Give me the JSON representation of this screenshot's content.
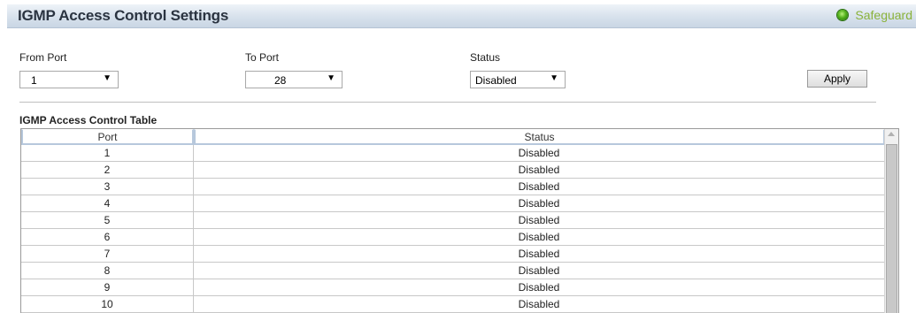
{
  "header": {
    "title": "IGMP Access Control Settings",
    "safeguard_label": "Safeguard",
    "safeguard_icon": "status-dot-icon"
  },
  "form": {
    "from_port_label": "From Port",
    "from_port_value": "1",
    "to_port_label": "To Port",
    "to_port_value": "28",
    "status_label": "Status",
    "status_value": "Disabled",
    "apply_label": "Apply"
  },
  "table": {
    "title": "IGMP Access Control Table",
    "columns": [
      "Port",
      "Status"
    ],
    "rows": [
      {
        "port": "1",
        "status": "Disabled"
      },
      {
        "port": "2",
        "status": "Disabled"
      },
      {
        "port": "3",
        "status": "Disabled"
      },
      {
        "port": "4",
        "status": "Disabled"
      },
      {
        "port": "5",
        "status": "Disabled"
      },
      {
        "port": "6",
        "status": "Disabled"
      },
      {
        "port": "7",
        "status": "Disabled"
      },
      {
        "port": "8",
        "status": "Disabled"
      },
      {
        "port": "9",
        "status": "Disabled"
      },
      {
        "port": "10",
        "status": "Disabled"
      }
    ]
  },
  "colors": {
    "title_text": "#2a3340",
    "safeguard_text": "#8ab23a",
    "header_border": "#b7c8dc"
  }
}
